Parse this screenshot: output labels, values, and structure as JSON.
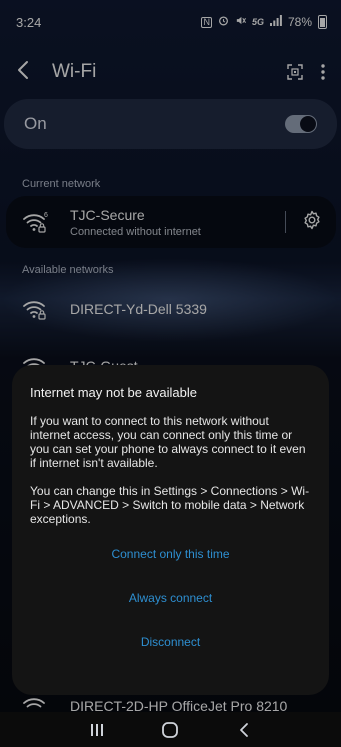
{
  "status_bar": {
    "time": "3:24",
    "nfc": "N",
    "alarm": "⏰",
    "mute": "🔇",
    "network": "5G",
    "signal": "▂▄▆",
    "battery": "78%"
  },
  "app_bar": {
    "title": "Wi-Fi",
    "back_icon": "chevron-left-icon",
    "scan_icon": "qr-scan-icon",
    "more_icon": "more-vertical-icon"
  },
  "wifi_toggle": {
    "label": "On",
    "enabled": true
  },
  "current_network": {
    "section_label": "Current network",
    "name": "TJC-Secure",
    "status": "Connected without internet",
    "wifi_badge": "6"
  },
  "available_networks": {
    "section_label": "Available networks",
    "items": [
      {
        "name": "DIRECT-Yd-Dell 5339"
      },
      {
        "name": "TJC-Guest"
      },
      {
        "name": "DIRECT-2D-HP OfficeJet Pro 8210"
      }
    ]
  },
  "dialog": {
    "title": "Internet may not be available",
    "paragraph1": "If you want to connect to this network without internet access, you can connect only this time or you can set your phone to always connect to it even if internet isn't available.",
    "paragraph2": "You can change this in Settings > Connections > Wi-Fi > ADVANCED > Switch to mobile data > Network exceptions.",
    "actions": [
      {
        "label": "Connect only this time"
      },
      {
        "label": "Always connect"
      },
      {
        "label": "Disconnect"
      }
    ]
  },
  "colors": {
    "accent": "#2e8fd1",
    "dialog_bg": "#141414",
    "card_bg": "#232d46"
  }
}
